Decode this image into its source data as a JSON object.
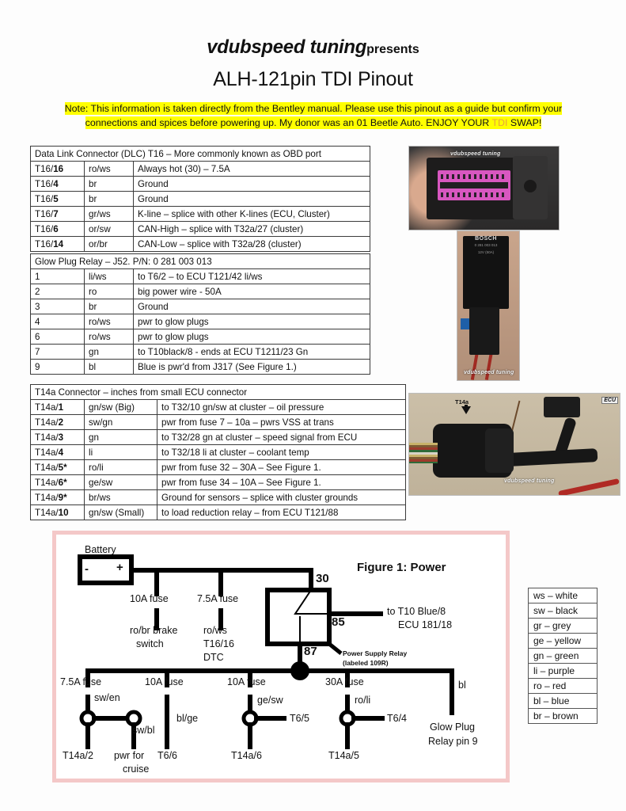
{
  "header": {
    "brand": "vdubspeed tuning",
    "presents": "presents",
    "title": "ALH-121pin TDI Pinout"
  },
  "note": {
    "part1": "Note: This information is taken directly from the Bentley manual. Please use this pinout as a guide but confirm your connections and spices before powering up. My donor was an 01 Beetle Auto. ENJOY YOUR ",
    "highlight_word": "TDI",
    "part2": " SWAP!",
    "highlight_color": "#ffff00",
    "tdi_color": "#e8a33d"
  },
  "dlc_table": {
    "header": "Data Link Connector (DLC) T16 – More commonly known as OBD port",
    "rows": [
      {
        "pin_prefix": "T16/",
        "pin_num": "16",
        "color": "ro/ws",
        "desc": "Always hot (30) – 7.5A"
      },
      {
        "pin_prefix": "T16/",
        "pin_num": "4",
        "color": "br",
        "desc": "Ground"
      },
      {
        "pin_prefix": "T16/",
        "pin_num": "5",
        "color": "br",
        "desc": "Ground"
      },
      {
        "pin_prefix": "T16/",
        "pin_num": "7",
        "color": "gr/ws",
        "desc": "K-line – splice with other K-lines (ECU, Cluster)"
      },
      {
        "pin_prefix": "T16/",
        "pin_num": "6",
        "color": "or/sw",
        "desc": "CAN-High – splice with T32a/27 (cluster)"
      },
      {
        "pin_prefix": "T16/",
        "pin_num": "14",
        "color": "or/br",
        "desc": "CAN-Low – splice with T32a/28 (cluster)"
      }
    ]
  },
  "glow_table": {
    "header": "Glow Plug Relay – J52. P/N: 0 281 003 013",
    "rows": [
      {
        "pin_prefix": "",
        "pin_num": "1",
        "color": "li/ws",
        "desc": "to T6/2 – to ECU T121/42 li/ws"
      },
      {
        "pin_prefix": "",
        "pin_num": "2",
        "color": "ro",
        "desc": "big power wire - 50A"
      },
      {
        "pin_prefix": "",
        "pin_num": "3",
        "color": "br",
        "desc": "Ground"
      },
      {
        "pin_prefix": "",
        "pin_num": "4",
        "color": "ro/ws",
        "desc": "pwr to glow plugs"
      },
      {
        "pin_prefix": "",
        "pin_num": "6",
        "color": "ro/ws",
        "desc": "pwr to glow plugs"
      },
      {
        "pin_prefix": "",
        "pin_num": "7",
        "color": "gn",
        "desc": "to T10black/8  - ends at ECU T1211/23 Gn"
      },
      {
        "pin_prefix": "",
        "pin_num": "9",
        "color": "bl",
        "desc": "Blue is pwr'd from J317 (See Figure 1.)"
      }
    ]
  },
  "t14a_table": {
    "header": "T14a Connector – inches from small ECU connector",
    "rows": [
      {
        "pin_prefix": "T14a/",
        "pin_num": "1",
        "color": "gn/sw (Big)",
        "desc": "to T32/10 gn/sw at cluster – oil pressure"
      },
      {
        "pin_prefix": "T14a/",
        "pin_num": "2",
        "color": "sw/gn",
        "desc": "pwr from fuse 7 – 10a – pwrs VSS at trans"
      },
      {
        "pin_prefix": "T14a/",
        "pin_num": "3",
        "color": "gn",
        "desc": "to T32/28 gn at cluster – speed signal from ECU"
      },
      {
        "pin_prefix": "T14a/",
        "pin_num": "4",
        "color": "li",
        "desc": "to T32/18 li at cluster – coolant temp"
      },
      {
        "pin_prefix": "T14a/",
        "pin_num": "5*",
        "color": "ro/li",
        "desc": "pwr from fuse 32 – 30A – See Figure 1."
      },
      {
        "pin_prefix": "T14a/",
        "pin_num": "6*",
        "color": "ge/sw",
        "desc": "pwr from fuse 34 – 10A – See Figure 1."
      },
      {
        "pin_prefix": "T14a/",
        "pin_num": "9*",
        "color": "br/ws",
        "desc": "Ground for sensors – splice with cluster grounds"
      },
      {
        "pin_prefix": "T14a/",
        "pin_num": "10",
        "color": "gn/sw (Small)",
        "desc": "to load reduction relay – from ECU T121/88"
      }
    ]
  },
  "legend": {
    "rows": [
      "ws – white",
      "sw – black",
      "gr – grey",
      "ge – yellow",
      "gn – green",
      "li – purple",
      "ro – red",
      "bl – blue",
      "br – brown"
    ]
  },
  "photos": {
    "obd": {
      "watermark": "vdubspeed tuning"
    },
    "relay": {
      "brand": "BOSCH",
      "part_no": "0 281 003 013",
      "spec": "12V  (50A)",
      "watermark": "vdubspeed tuning"
    },
    "t14a": {
      "label": "T14a",
      "ecu_label": "ECU",
      "watermark": "vdubspeed tuning"
    }
  },
  "figure1": {
    "title": "Figure 1: Power",
    "battery_label": "Battery",
    "battery_minus": "-",
    "battery_plus": "+",
    "fuse_10a_brake": "10A fuse",
    "brake_wire": "ro/br brake",
    "brake_wire2": "switch",
    "fuse_75a_dtc": "7.5A fuse",
    "dtc_wire": "ro/ws",
    "dtc_pin": "T16/16",
    "dtc_label": "DTC",
    "relay_30": "30",
    "relay_85": "85",
    "relay_87": "87",
    "relay_out1": "to T10 Blue/8",
    "relay_out2": "ECU 181/18",
    "relay_caption1": "Power Supply Relay",
    "relay_caption2": "(labeled 109R)",
    "branches": [
      {
        "fuse": "7.5A fuse",
        "wire": "sw/en",
        "pin": "T14a/2"
      },
      {
        "fuse": "",
        "wire": "sw/bl",
        "pin": "pwr for",
        "pin2": "cruise"
      },
      {
        "fuse": "10A fuse",
        "wire": "bl/ge",
        "pin": "T6/6"
      },
      {
        "fuse": "10A fuse",
        "wire": "ge/sw",
        "pin": "T14a/6",
        "side": "T6/5"
      },
      {
        "fuse": "30A fuse",
        "wire": "ro/li",
        "pin": "T14a/5",
        "side": "T6/4"
      },
      {
        "fuse": "",
        "wire": "bl",
        "pin": "Glow Plug",
        "pin2": "Relay pin 9"
      }
    ]
  }
}
